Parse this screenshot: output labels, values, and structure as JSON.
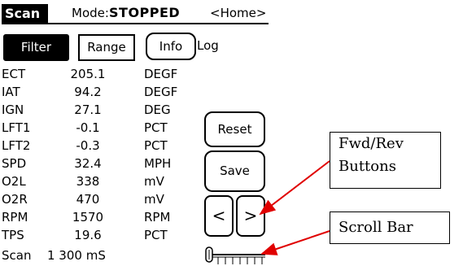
{
  "header": {
    "app_title": "Scan",
    "mode_prefix": "Mode:",
    "mode_value": "STOPPED",
    "home_link": "<Home>"
  },
  "tabs": {
    "filter": "Filter",
    "range": "Range",
    "info": "Info",
    "log": "Log"
  },
  "params": [
    {
      "name": "ECT",
      "value": "205.1",
      "unit": "DEGF"
    },
    {
      "name": "IAT",
      "value": "94.2",
      "unit": "DEGF"
    },
    {
      "name": "IGN",
      "value": "27.1",
      "unit": "DEG"
    },
    {
      "name": "LFT1",
      "value": "-0.1",
      "unit": "PCT"
    },
    {
      "name": "LFT2",
      "value": "-0.3",
      "unit": "PCT"
    },
    {
      "name": "SPD",
      "value": "32.4",
      "unit": "MPH"
    },
    {
      "name": "O2L",
      "value": "338",
      "unit": "mV"
    },
    {
      "name": "O2R",
      "value": "470",
      "unit": "mV"
    },
    {
      "name": "RPM",
      "value": "1570",
      "unit": "RPM"
    },
    {
      "name": "TPS",
      "value": "19.6",
      "unit": "PCT"
    }
  ],
  "buttons": {
    "reset": "Reset",
    "save": "Save",
    "prev": "<",
    "next": ">"
  },
  "status": {
    "label": "Scan",
    "value": "1 300 mS"
  },
  "scrollbar": {
    "position": 0.0
  },
  "callouts": {
    "fwd_rev_line1": "Fwd/Rev",
    "fwd_rev_line2": "Buttons",
    "scroll_bar": "Scroll Bar"
  },
  "colors": {
    "arrow": "#e00000",
    "foreground": "#000000",
    "background": "#ffffff"
  }
}
